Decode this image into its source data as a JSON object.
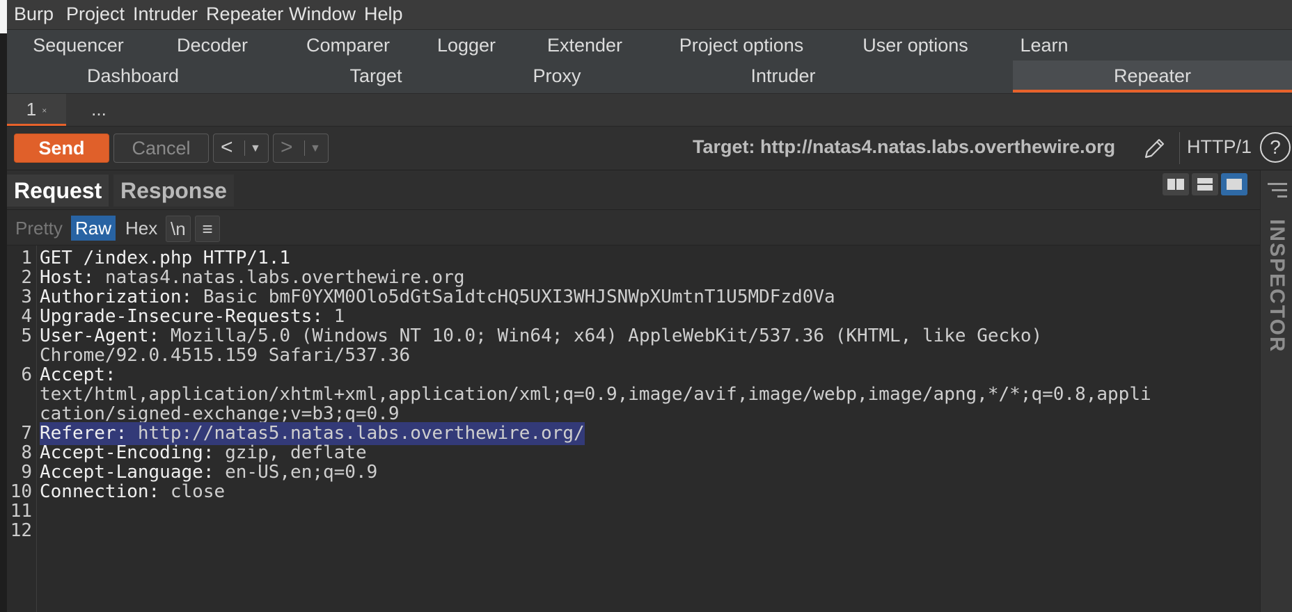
{
  "menu": [
    "Burp",
    "Project",
    "Intruder",
    "Repeater",
    "Window",
    "Help"
  ],
  "tabs_row1": [
    "Sequencer",
    "Decoder",
    "Comparer",
    "Logger",
    "Extender",
    "Project options",
    "User options",
    "Learn"
  ],
  "tabs_row2": [
    "Dashboard",
    "Target",
    "Proxy",
    "Intruder",
    "Repeater"
  ],
  "active_tab": "Repeater",
  "repeater_tabs": [
    "1",
    "..."
  ],
  "repeater_tab_close": "×",
  "toolbar": {
    "send_label": "Send",
    "cancel_label": "Cancel",
    "back_arrow": "<",
    "forward_arrow": ">",
    "dropdown_caret": "▼",
    "target_text": "Target: http://natas4.natas.labs.overthewire.org",
    "http_version": "HTTP/1",
    "help_glyph": "?"
  },
  "panel": {
    "request_tab": "Request",
    "response_tab": "Response",
    "view_buttons": [
      "Pretty",
      "Raw",
      "Hex",
      "\\n",
      "≡"
    ],
    "active_view": "Raw"
  },
  "inspector_label": "INSPECTOR",
  "request_lines": [
    {
      "num": "1",
      "name": "GET /index.php HTTP/1.1",
      "value": ""
    },
    {
      "num": "2",
      "name": "Host",
      "value": "natas4.natas.labs.overthewire.org"
    },
    {
      "num": "3",
      "name": "Authorization",
      "value": "Basic bmF0YXM0Olo5dGtSa1dtcHQ5UXI3WHJSNWpXUmtnT1U5MDFzd0Va"
    },
    {
      "num": "4",
      "name": "Upgrade-Insecure-Requests",
      "value": "1"
    },
    {
      "num": "5",
      "name": "User-Agent",
      "value": "Mozilla/5.0 (Windows NT 10.0; Win64; x64) AppleWebKit/537.36 (KHTML, like Gecko)",
      "cont": [
        "Chrome/92.0.4515.159 Safari/537.36"
      ]
    },
    {
      "num": "6",
      "name": "Accept",
      "value": "",
      "cont": [
        "text/html,application/xhtml+xml,application/xml;q=0.9,image/avif,image/webp,image/apng,*/*;q=0.8,appli",
        "cation/signed-exchange;v=b3;q=0.9"
      ]
    },
    {
      "num": "7",
      "name": "Referer",
      "value": "http://natas5.natas.labs.overthewire.org/",
      "highlight": true
    },
    {
      "num": "8",
      "name": "Accept-Encoding",
      "value": "gzip, deflate"
    },
    {
      "num": "9",
      "name": "Accept-Language",
      "value": "en-US,en;q=0.9"
    },
    {
      "num": "10",
      "name": "Connection",
      "value": "close"
    },
    {
      "num": "11",
      "name": "",
      "value": ""
    },
    {
      "num": "12",
      "name": "",
      "value": ""
    }
  ],
  "colors": {
    "accent": "#e8622b",
    "send_button": "#e0602a",
    "raw_active": "#2863a3",
    "highlight": "#333a78"
  }
}
